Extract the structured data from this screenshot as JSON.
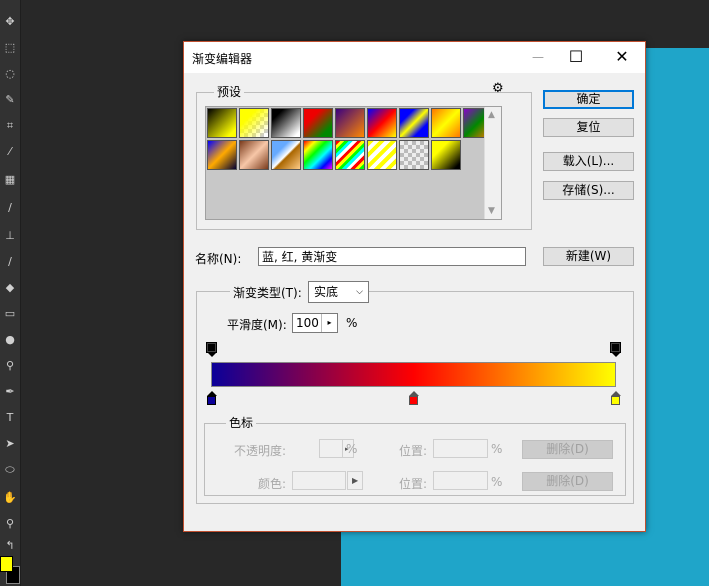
{
  "dialog": {
    "title": "渐变编辑器",
    "minimize_glyph": "—",
    "maximize_glyph": "☐",
    "close_glyph": "✕"
  },
  "presets": {
    "label": "预设",
    "gear_glyph": "⚙",
    "swatches": [
      "black-to-yellow",
      "yellow-to-transparent",
      "black-to-white",
      "red-to-green",
      "violet-to-orange",
      "blue-red-yellow",
      "blue-yellow-blue",
      "orange-yellow-orange",
      "violet-green-orange",
      "blue-to-yellow-orange",
      "copper",
      "chrome",
      "spectrum",
      "transparent-rainbow",
      "transparent-stripes",
      "transparent",
      "yellow-to-black"
    ]
  },
  "buttons": {
    "ok": "确定",
    "reset": "复位",
    "load": "载入(L)...",
    "save": "存储(S)...",
    "new": "新建(W)"
  },
  "name": {
    "label": "名称(N):",
    "value": "蓝, 红, 黄渐变"
  },
  "gradient": {
    "type_label": "渐变类型(T):",
    "type_value": "实底",
    "smoothness_label": "平滑度(M):",
    "smoothness_value": "100",
    "smoothness_unit": "%",
    "colors": {
      "left": "#0b0099",
      "mid": "#ff0000",
      "right": "#ffff00"
    }
  },
  "stops": {
    "label": "色标",
    "opacity_label": "不透明度:",
    "opacity_unit": "%",
    "location1_label": "位置:",
    "location1_unit": "%",
    "delete1": "删除(D)",
    "color_label": "颜色:",
    "location2_label": "位置:",
    "location2_unit": "%",
    "delete2": "删除(D)"
  },
  "photoshop": {
    "foreground_color": "#ffff00",
    "background_color": "#000000",
    "canvas_color": "#1fa5c9"
  }
}
